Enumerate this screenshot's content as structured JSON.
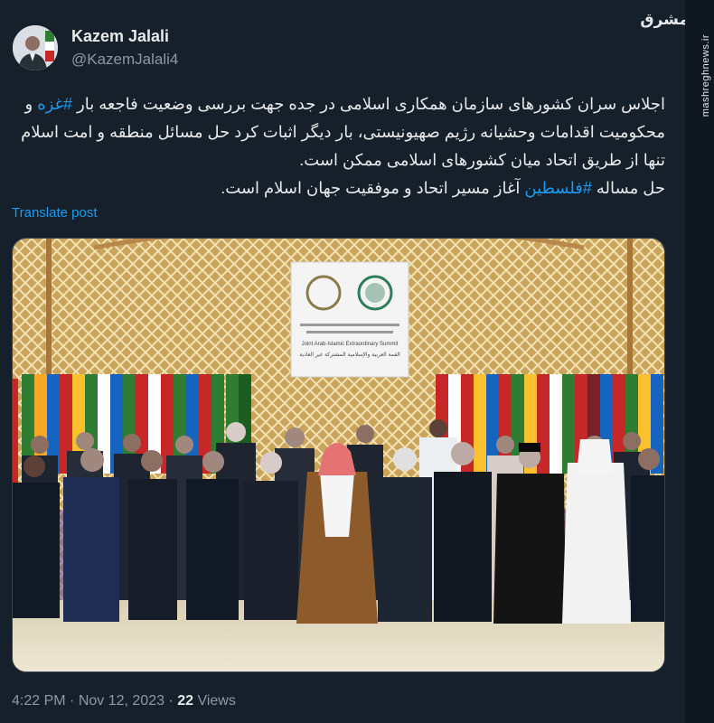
{
  "author": {
    "name": "Kazem Jalali",
    "handle": "@KazemJalali4"
  },
  "post": {
    "text_part1": "اجلاس سران کشورهای سازمان همکاری اسلامی در جده جهت بررسی وضعیت فاجعه بار ",
    "hashtag1": "#غزه",
    "text_part2": " و محکومیت اقدامات وحشیانه رژیم صهیونیستی، بار دیگر اثبات کرد حل مسائل منطقه و امت اسلام تنها از طریق اتحاد میان کشورهای اسلامی ممکن است.",
    "text_part3": "حل مساله ",
    "hashtag2": "#فلسطین",
    "text_part4": " آغاز مسیر اتحاد و موفقیت جهان اسلام است.",
    "translate_label": "Translate post"
  },
  "photo": {
    "banner_title_ar": "القمة العربية والإسلامية المشتركة غير العادية",
    "banner_title_en": "Joint Arab-Islamic Extraordinary Summit"
  },
  "meta": {
    "time": "4:22 PM",
    "date": "Nov 12, 2023",
    "views_count": "22",
    "views_label": "Views"
  },
  "watermark": {
    "site": "mashreghnews.ir",
    "logo": "مشرق"
  }
}
